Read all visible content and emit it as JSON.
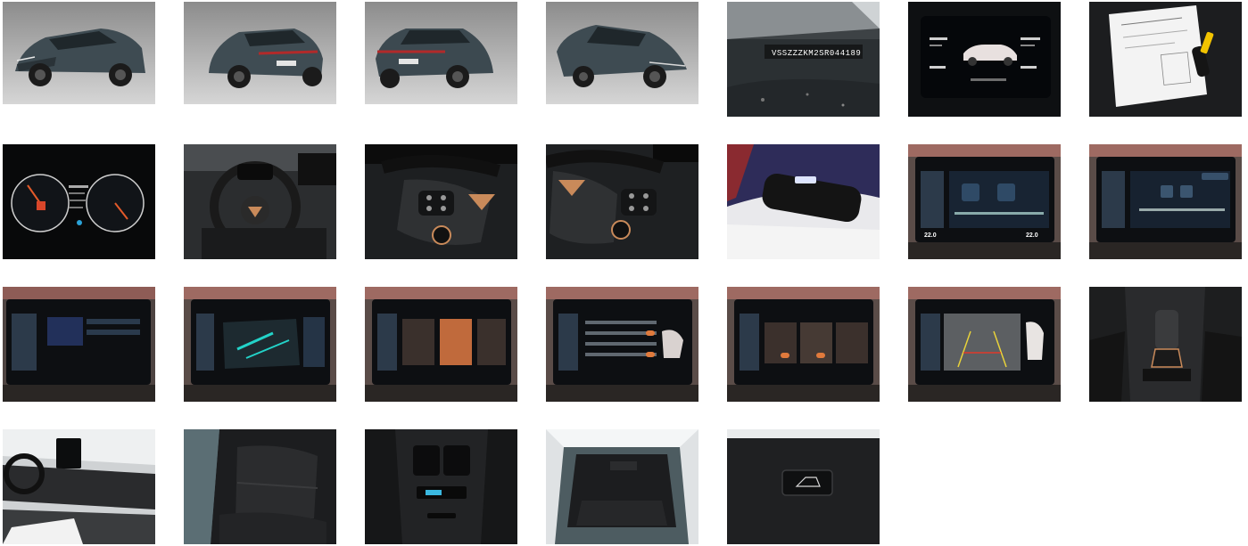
{
  "gallery": {
    "vin_text": "VSSZZZKM2SR044189",
    "screen_temp_left": "22.0",
    "screen_temp_right": "22.0",
    "thumbnails": [
      {
        "name": "photo-exterior-front-left"
      },
      {
        "name": "photo-exterior-rear-left"
      },
      {
        "name": "photo-exterior-rear-right"
      },
      {
        "name": "photo-exterior-front-right"
      },
      {
        "name": "photo-vin-plate"
      },
      {
        "name": "photo-digital-cockpit"
      },
      {
        "name": "photo-documents-keys"
      },
      {
        "name": "photo-instrument-cluster"
      },
      {
        "name": "photo-steering-wheel"
      },
      {
        "name": "photo-steering-left-controls"
      },
      {
        "name": "photo-steering-right-controls"
      },
      {
        "name": "photo-interior-mirror"
      },
      {
        "name": "photo-infotainment-fulllink"
      },
      {
        "name": "photo-infotainment-bluetooth"
      },
      {
        "name": "photo-infotainment-menu"
      },
      {
        "name": "photo-infotainment-ambient"
      },
      {
        "name": "photo-infotainment-driving-profile"
      },
      {
        "name": "photo-infotainment-assist"
      },
      {
        "name": "photo-infotainment-comfort"
      },
      {
        "name": "photo-rear-camera"
      },
      {
        "name": "photo-gear-selector"
      },
      {
        "name": "photo-dashboard-side"
      },
      {
        "name": "photo-rear-seats"
      },
      {
        "name": "photo-rear-vents"
      },
      {
        "name": "photo-trunk"
      },
      {
        "name": "photo-trunk-button"
      }
    ]
  }
}
